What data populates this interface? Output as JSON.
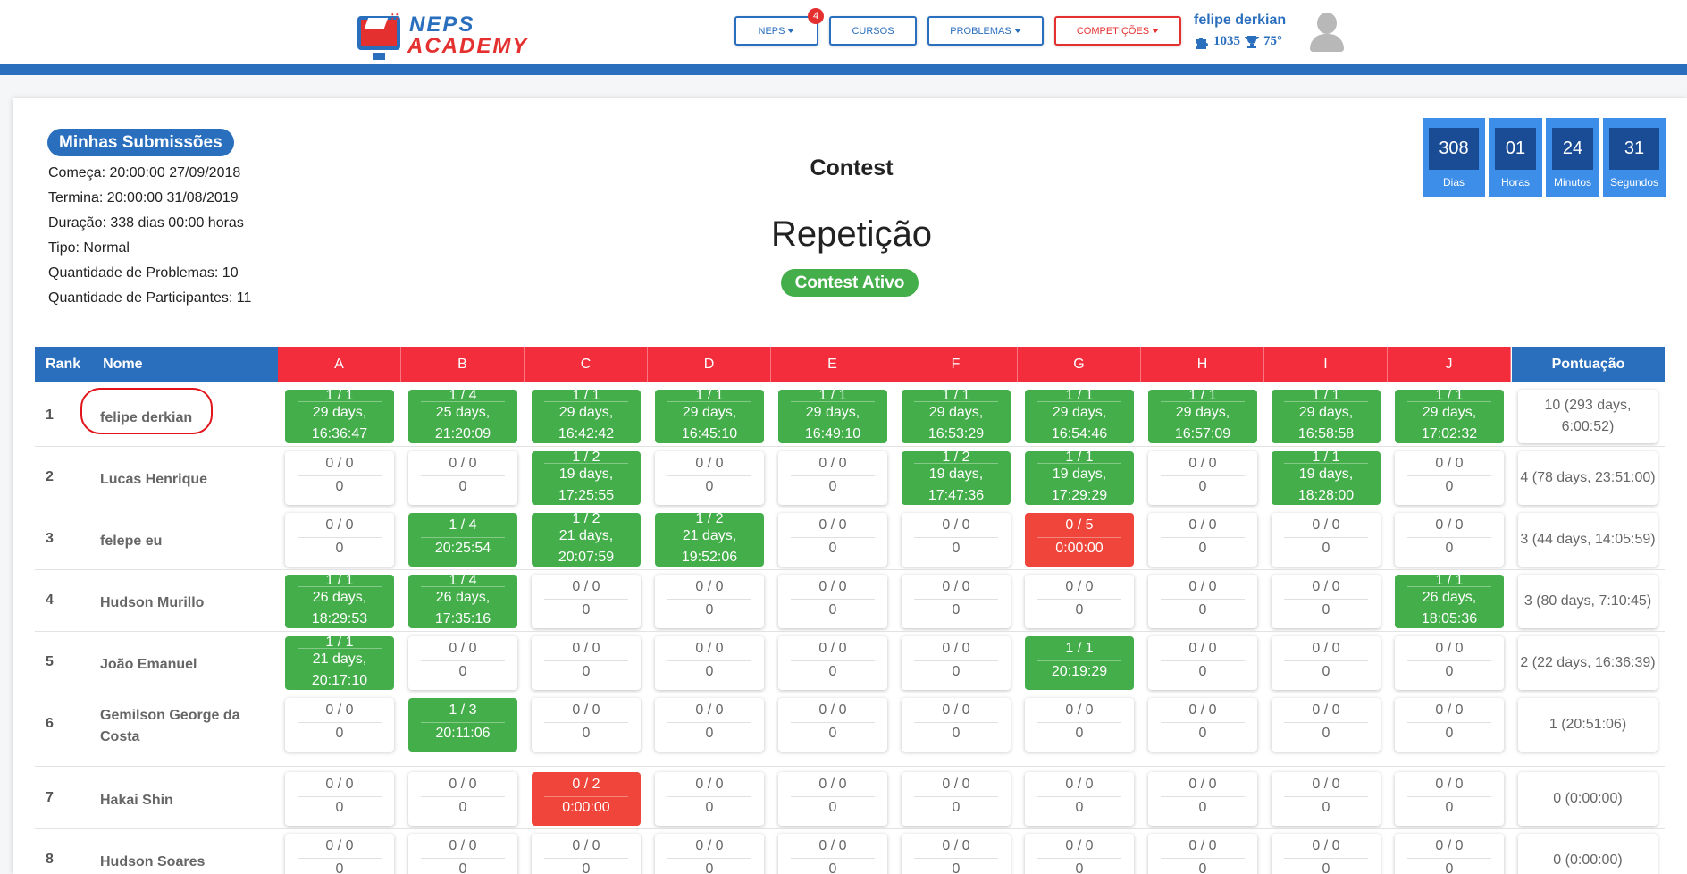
{
  "header": {
    "logo_top": "NEPS",
    "logo_bottom": "ACADEMY",
    "nav": [
      {
        "label": "NEPS",
        "badge": "4"
      },
      {
        "label": "CURSOS"
      },
      {
        "label": "PROBLEMAS"
      },
      {
        "label": "COMPETIÇÕES"
      }
    ],
    "user": {
      "name": "felipe derkian",
      "points": "1035",
      "rank": "75°"
    }
  },
  "info": {
    "submissions_button": "Minhas Submissões",
    "lines": [
      "Começa: 20:00:00 27/09/2018",
      "Termina: 20:00:00 31/08/2019",
      "Duração: 338 dias 00:00 horas",
      "Tipo: Normal",
      "Quantidade de Problemas: 10",
      "Quantidade de Participantes: 11"
    ]
  },
  "contest": {
    "title": "Contest",
    "name": "Repetição",
    "status": "Contest Ativo"
  },
  "timer": [
    {
      "value": "308",
      "label": "Dias"
    },
    {
      "value": "01",
      "label": "Horas"
    },
    {
      "value": "24",
      "label": "Minutos"
    },
    {
      "value": "31",
      "label": "Segundos"
    }
  ],
  "table": {
    "headers": {
      "rank": "Rank",
      "name": "Nome",
      "score": "Pontuação"
    },
    "problems": [
      "A",
      "B",
      "C",
      "D",
      "E",
      "F",
      "G",
      "H",
      "I",
      "J"
    ],
    "rows": [
      {
        "rank": "1",
        "name": "felipe derkian",
        "score": "10 (293 days, 6:00:52)",
        "cells": [
          {
            "s": "g",
            "t": "1 / 1",
            "b": "29 days, 16:36:47"
          },
          {
            "s": "g",
            "t": "1 / 4",
            "b": "25 days, 21:20:09"
          },
          {
            "s": "g",
            "t": "1 / 1",
            "b": "29 days, 16:42:42"
          },
          {
            "s": "g",
            "t": "1 / 1",
            "b": "29 days, 16:45:10"
          },
          {
            "s": "g",
            "t": "1 / 1",
            "b": "29 days, 16:49:10"
          },
          {
            "s": "g",
            "t": "1 / 1",
            "b": "29 days, 16:53:29"
          },
          {
            "s": "g",
            "t": "1 / 1",
            "b": "29 days, 16:54:46"
          },
          {
            "s": "g",
            "t": "1 / 1",
            "b": "29 days, 16:57:09"
          },
          {
            "s": "g",
            "t": "1 / 1",
            "b": "29 days, 16:58:58"
          },
          {
            "s": "g",
            "t": "1 / 1",
            "b": "29 days, 17:02:32"
          }
        ]
      },
      {
        "rank": "2",
        "name": "Lucas Henrique",
        "score": "4 (78 days, 23:51:00)",
        "cells": [
          {
            "s": "w",
            "t": "0 / 0",
            "b": "0"
          },
          {
            "s": "w",
            "t": "0 / 0",
            "b": "0"
          },
          {
            "s": "g",
            "t": "1 / 2",
            "b": "19 days, 17:25:55"
          },
          {
            "s": "w",
            "t": "0 / 0",
            "b": "0"
          },
          {
            "s": "w",
            "t": "0 / 0",
            "b": "0"
          },
          {
            "s": "g",
            "t": "1 / 2",
            "b": "19 days, 17:47:36"
          },
          {
            "s": "g",
            "t": "1 / 1",
            "b": "19 days, 17:29:29"
          },
          {
            "s": "w",
            "t": "0 / 0",
            "b": "0"
          },
          {
            "s": "g",
            "t": "1 / 1",
            "b": "19 days, 18:28:00"
          },
          {
            "s": "w",
            "t": "0 / 0",
            "b": "0"
          }
        ]
      },
      {
        "rank": "3",
        "name": "felepe eu",
        "score": "3 (44 days, 14:05:59)",
        "cells": [
          {
            "s": "w",
            "t": "0 / 0",
            "b": "0"
          },
          {
            "s": "g",
            "t": "1 / 4",
            "b": "20:25:54"
          },
          {
            "s": "g",
            "t": "1 / 2",
            "b": "21 days, 20:07:59"
          },
          {
            "s": "g",
            "t": "1 / 2",
            "b": "21 days, 19:52:06"
          },
          {
            "s": "w",
            "t": "0 / 0",
            "b": "0"
          },
          {
            "s": "w",
            "t": "0 / 0",
            "b": "0"
          },
          {
            "s": "r",
            "t": "0 / 5",
            "b": "0:00:00"
          },
          {
            "s": "w",
            "t": "0 / 0",
            "b": "0"
          },
          {
            "s": "w",
            "t": "0 / 0",
            "b": "0"
          },
          {
            "s": "w",
            "t": "0 / 0",
            "b": "0"
          }
        ]
      },
      {
        "rank": "4",
        "name": "Hudson Murillo",
        "score": "3 (80 days, 7:10:45)",
        "cells": [
          {
            "s": "g",
            "t": "1 / 1",
            "b": "26 days, 18:29:53"
          },
          {
            "s": "g",
            "t": "1 / 4",
            "b": "26 days, 17:35:16"
          },
          {
            "s": "w",
            "t": "0 / 0",
            "b": "0"
          },
          {
            "s": "w",
            "t": "0 / 0",
            "b": "0"
          },
          {
            "s": "w",
            "t": "0 / 0",
            "b": "0"
          },
          {
            "s": "w",
            "t": "0 / 0",
            "b": "0"
          },
          {
            "s": "w",
            "t": "0 / 0",
            "b": "0"
          },
          {
            "s": "w",
            "t": "0 / 0",
            "b": "0"
          },
          {
            "s": "w",
            "t": "0 / 0",
            "b": "0"
          },
          {
            "s": "g",
            "t": "1 / 1",
            "b": "26 days, 18:05:36"
          }
        ]
      },
      {
        "rank": "5",
        "name": "João Emanuel",
        "score": "2 (22 days, 16:36:39)",
        "cells": [
          {
            "s": "g",
            "t": "1 / 1",
            "b": "21 days, 20:17:10"
          },
          {
            "s": "w",
            "t": "0 / 0",
            "b": "0"
          },
          {
            "s": "w",
            "t": "0 / 0",
            "b": "0"
          },
          {
            "s": "w",
            "t": "0 / 0",
            "b": "0"
          },
          {
            "s": "w",
            "t": "0 / 0",
            "b": "0"
          },
          {
            "s": "w",
            "t": "0 / 0",
            "b": "0"
          },
          {
            "s": "g",
            "t": "1 / 1",
            "b": "20:19:29"
          },
          {
            "s": "w",
            "t": "0 / 0",
            "b": "0"
          },
          {
            "s": "w",
            "t": "0 / 0",
            "b": "0"
          },
          {
            "s": "w",
            "t": "0 / 0",
            "b": "0"
          }
        ]
      },
      {
        "rank": "6",
        "name": "Gemilson George da Costa",
        "score": "1 (20:51:06)",
        "cells": [
          {
            "s": "w",
            "t": "0 / 0",
            "b": "0"
          },
          {
            "s": "g",
            "t": "1 / 3",
            "b": "20:11:06"
          },
          {
            "s": "w",
            "t": "0 / 0",
            "b": "0"
          },
          {
            "s": "w",
            "t": "0 / 0",
            "b": "0"
          },
          {
            "s": "w",
            "t": "0 / 0",
            "b": "0"
          },
          {
            "s": "w",
            "t": "0 / 0",
            "b": "0"
          },
          {
            "s": "w",
            "t": "0 / 0",
            "b": "0"
          },
          {
            "s": "w",
            "t": "0 / 0",
            "b": "0"
          },
          {
            "s": "w",
            "t": "0 / 0",
            "b": "0"
          },
          {
            "s": "w",
            "t": "0 / 0",
            "b": "0"
          }
        ]
      },
      {
        "rank": "7",
        "name": "Hakai Shin",
        "score": "0 (0:00:00)",
        "cells": [
          {
            "s": "w",
            "t": "0 / 0",
            "b": "0"
          },
          {
            "s": "w",
            "t": "0 / 0",
            "b": "0"
          },
          {
            "s": "r",
            "t": "0 / 2",
            "b": "0:00:00"
          },
          {
            "s": "w",
            "t": "0 / 0",
            "b": "0"
          },
          {
            "s": "w",
            "t": "0 / 0",
            "b": "0"
          },
          {
            "s": "w",
            "t": "0 / 0",
            "b": "0"
          },
          {
            "s": "w",
            "t": "0 / 0",
            "b": "0"
          },
          {
            "s": "w",
            "t": "0 / 0",
            "b": "0"
          },
          {
            "s": "w",
            "t": "0 / 0",
            "b": "0"
          },
          {
            "s": "w",
            "t": "0 / 0",
            "b": "0"
          }
        ]
      },
      {
        "rank": "8",
        "name": "Hudson Soares",
        "score": "0 (0:00:00)",
        "cells": [
          {
            "s": "w",
            "t": "0 / 0",
            "b": "0"
          },
          {
            "s": "w",
            "t": "0 / 0",
            "b": "0"
          },
          {
            "s": "w",
            "t": "0 / 0",
            "b": "0"
          },
          {
            "s": "w",
            "t": "0 / 0",
            "b": "0"
          },
          {
            "s": "w",
            "t": "0 / 0",
            "b": "0"
          },
          {
            "s": "w",
            "t": "0 / 0",
            "b": "0"
          },
          {
            "s": "w",
            "t": "0 / 0",
            "b": "0"
          },
          {
            "s": "w",
            "t": "0 / 0",
            "b": "0"
          },
          {
            "s": "w",
            "t": "0 / 0",
            "b": "0"
          },
          {
            "s": "w",
            "t": "0 / 0",
            "b": "0"
          }
        ]
      }
    ]
  }
}
